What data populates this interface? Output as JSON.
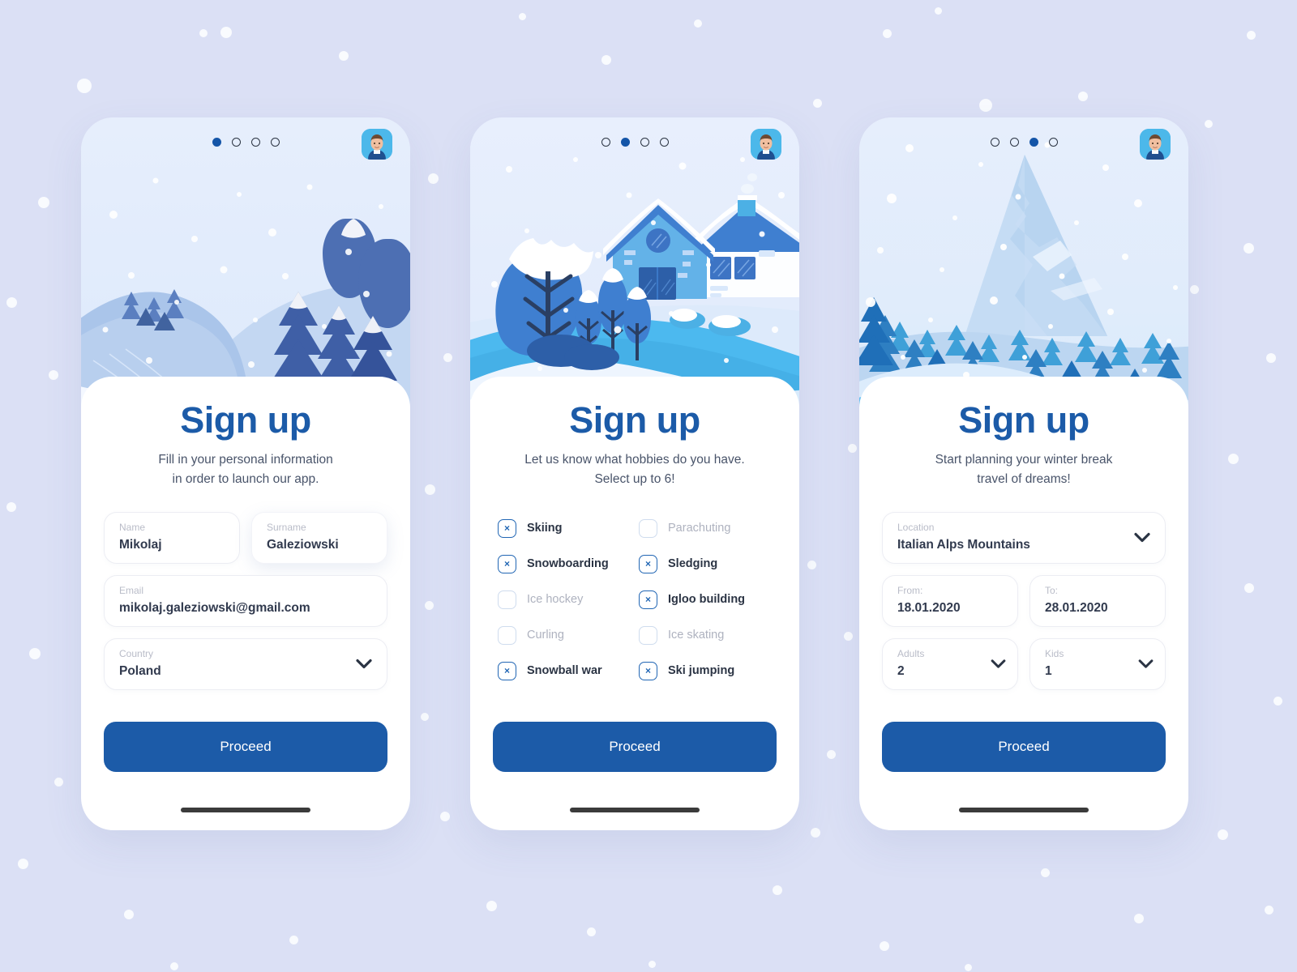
{
  "background": {
    "color": "#dbe0f5"
  },
  "theme": {
    "primary": "#1c5ba8",
    "title_color": "#1c5ba8",
    "subtitle_color": "#49546a",
    "label_color": "#b9bcc8",
    "value_color": "#313a4e",
    "checkbox_on": "#2166b4",
    "checkbox_off": "#cfdcee",
    "avatar_bg": "#4cb8ea"
  },
  "screens": [
    {
      "id": "screen-personal-info",
      "illustration": "winter-forest-slope",
      "pager": {
        "total": 4,
        "active": 1
      },
      "avatar": {
        "name": "user-avatar",
        "label": "User avatar"
      },
      "title": "Sign up",
      "subtitle_line1": "Fill in your personal information",
      "subtitle_line2": "in order to launch our app.",
      "fields": [
        {
          "name": "name-field",
          "label": "Name",
          "value": "Mikolaj",
          "type": "text",
          "focused": false
        },
        {
          "name": "surname-field",
          "label": "Surname",
          "value": "Galeziowski",
          "type": "text",
          "focused": true
        },
        {
          "name": "email-field",
          "label": "Email",
          "value": "mikolaj.galeziowski@gmail.com",
          "type": "text",
          "focused": false
        },
        {
          "name": "country-select",
          "label": "Country",
          "value": "Poland",
          "type": "select",
          "focused": false
        }
      ],
      "proceed_label": "Proceed"
    },
    {
      "id": "screen-hobbies",
      "illustration": "winter-house-hill",
      "pager": {
        "total": 4,
        "active": 2
      },
      "avatar": {
        "name": "user-avatar",
        "label": "User avatar"
      },
      "title": "Sign up",
      "subtitle_line1": "Let us know what hobbies do you have.",
      "subtitle_line2": "Select up to 6!",
      "hobbies": [
        {
          "name": "hobby-skiing",
          "label": "Skiing",
          "checked": true
        },
        {
          "name": "hobby-parachuting",
          "label": "Parachuting",
          "checked": false
        },
        {
          "name": "hobby-snowboarding",
          "label": "Snowboarding",
          "checked": true
        },
        {
          "name": "hobby-sledging",
          "label": "Sledging",
          "checked": true
        },
        {
          "name": "hobby-ice-hockey",
          "label": "Ice hockey",
          "checked": false
        },
        {
          "name": "hobby-igloo-building",
          "label": "Igloo building",
          "checked": true
        },
        {
          "name": "hobby-curling",
          "label": "Curling",
          "checked": false
        },
        {
          "name": "hobby-ice-skating",
          "label": "Ice skating",
          "checked": false
        },
        {
          "name": "hobby-snowball-war",
          "label": "Snowball war",
          "checked": true
        },
        {
          "name": "hobby-ski-jumping",
          "label": "Ski jumping",
          "checked": true
        }
      ],
      "checkbox_mark": "×",
      "proceed_label": "Proceed"
    },
    {
      "id": "screen-trip-planning",
      "illustration": "winter-mountain-peak",
      "pager": {
        "total": 4,
        "active": 3
      },
      "avatar": {
        "name": "user-avatar",
        "label": "User avatar"
      },
      "title": "Sign up",
      "subtitle_line1": "Start planning your winter break",
      "subtitle_line2": "travel of dreams!",
      "fields": [
        {
          "name": "location-select",
          "label": "Location",
          "value": "Italian Alps Mountains",
          "type": "select",
          "focused": false
        },
        {
          "name": "date-from-field",
          "label": "From:",
          "value": "18.01.2020",
          "type": "text",
          "focused": false
        },
        {
          "name": "date-to-field",
          "label": "To:",
          "value": "28.01.2020",
          "type": "text",
          "focused": false
        },
        {
          "name": "adults-select",
          "label": "Adults",
          "value": "2",
          "type": "select",
          "focused": false
        },
        {
          "name": "kids-select",
          "label": "Kids",
          "value": "1",
          "type": "select",
          "focused": false
        }
      ],
      "proceed_label": "Proceed"
    }
  ]
}
